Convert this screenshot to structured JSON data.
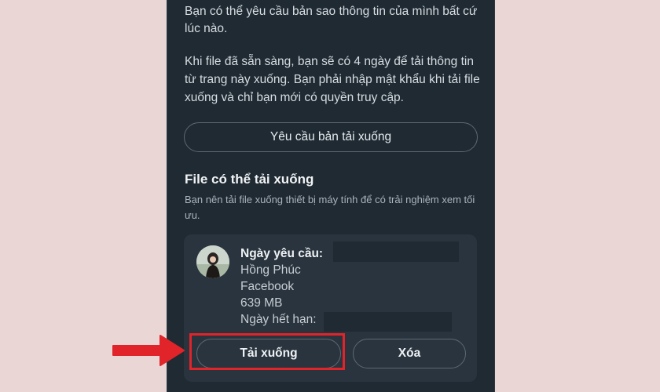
{
  "intro": {
    "paragraph1": "Bạn có thể yêu cầu bản sao thông tin của mình bất cứ lúc nào.",
    "paragraph2": "Khi file đã sẵn sàng, bạn sẽ có 4 ngày để tải thông tin từ trang này xuống. Bạn phải nhập mật khẩu khi tải file xuống và chỉ bạn mới có quyền truy cập."
  },
  "request_button": "Yêu cầu bản tải xuống",
  "section": {
    "title": "File có thể tải xuống",
    "description": "Bạn nên tải file xuống thiết bị máy tính để có trải nghiệm xem tối ưu."
  },
  "file_card": {
    "requested_label": "Ngày yêu cầu:",
    "name": "Hồng Phúc",
    "platform": "Facebook",
    "size": "639 MB",
    "expiry_label": "Ngày hết hạn:",
    "download_button": "Tải xuống",
    "delete_button": "Xóa"
  },
  "colors": {
    "background": "#ead6d5",
    "panel": "#1f2a33",
    "card": "#29343e",
    "highlight": "#e0242a"
  }
}
